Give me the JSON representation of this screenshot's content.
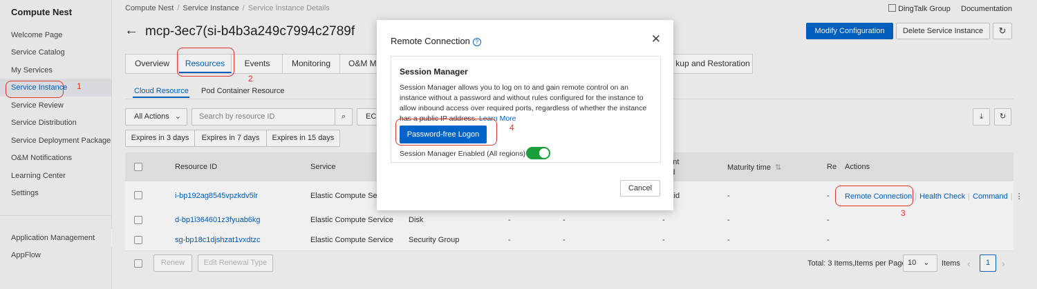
{
  "sidebar": {
    "title": "Compute Nest",
    "items": [
      {
        "label": "Welcome Page"
      },
      {
        "label": "Service Catalog"
      },
      {
        "label": "My Services"
      },
      {
        "label": "Service Instance"
      },
      {
        "label": "Service Review"
      },
      {
        "label": "Service Distribution"
      },
      {
        "label": "Service Deployment Package"
      },
      {
        "label": "O&M Notifications"
      },
      {
        "label": "Learning Center"
      },
      {
        "label": "Settings"
      }
    ],
    "bottom_items": [
      {
        "label": "Application Management"
      },
      {
        "label": "AppFlow"
      }
    ],
    "collapse_glyph": "‹"
  },
  "breadcrumb": {
    "items": [
      "Compute Nest",
      "Service Instance",
      "Service Instance Details"
    ],
    "sep": "/"
  },
  "topright": {
    "dingtalk": "DingTalk Group",
    "docs": "Documentation"
  },
  "header": {
    "back_glyph": "←",
    "title": "mcp-3ec7(si-b4b3a249c7994c2789f",
    "modify": "Modify Configuration",
    "delete": "Delete Service Instance",
    "refresh_glyph": "↻"
  },
  "tabs": [
    {
      "label": "Overview"
    },
    {
      "label": "Resources"
    },
    {
      "label": "Events"
    },
    {
      "label": "Monitoring"
    },
    {
      "label": "O&M Ma"
    },
    {
      "label": "kup and Restoration"
    }
  ],
  "subtabs": [
    {
      "label": "Cloud Resource"
    },
    {
      "label": "Pod Container Resource"
    }
  ],
  "toolbar": {
    "all_actions": "All Actions",
    "search_placeholder": "Search by resource ID",
    "ecs": "ECS",
    "expires": [
      "Expires in 3 days",
      "Expires in 7 days",
      "Expires in 15 days"
    ]
  },
  "table": {
    "headers": {
      "resource_id": "Resource ID",
      "service": "Service",
      "billing_1": "ment",
      "billing_2": "hod",
      "maturity": "Maturity time",
      "re": "Re",
      "actions": "Actions"
    },
    "rows": [
      {
        "id": "i-bp192ag8545vpzkdv5lr",
        "service": "Elastic Compute Service",
        "type": "",
        "c3": "",
        "c4": "",
        "billing": "tPaid",
        "maturity": "-",
        "re": "-"
      },
      {
        "id": "d-bp1i364601z3fyuab6kg",
        "service": "Elastic Compute Service",
        "type": "Disk",
        "c3": "-",
        "c4": "-",
        "billing": "-",
        "maturity": "-",
        "re": "-"
      },
      {
        "id": "sg-bp18c1djshzat1vxdtzc",
        "service": "Elastic Compute Service",
        "type": "Security Group",
        "c3": "-",
        "c4": "-",
        "billing": "-",
        "maturity": "-",
        "re": "-"
      }
    ],
    "row_actions": {
      "remote": "Remote Connection",
      "health": "Health Check",
      "command": "Command",
      "more": "⋮"
    }
  },
  "footer": {
    "renew": "Renew",
    "edit_renewal": "Edit Renewal Type",
    "total": "Total: 3 Items,",
    "per_page_label": "Items per Page",
    "per_page_value": "10",
    "items_suffix": "Items",
    "page": "1",
    "prev": "‹",
    "next": "›"
  },
  "modal": {
    "title": "Remote Connection",
    "help_glyph": "?",
    "close_glyph": "✕",
    "card_title": "Session Manager",
    "desc": "Session Manager allows you to log on to and gain remote control on an instance without a password and without rules configured for the instance to allow inbound access over required ports, regardless of whether the instance has a public IP address.",
    "learn_more": "Learn More",
    "logon": "Password-free Logon",
    "enabled_label": "Session Manager Enabled (All regions)",
    "cancel": "Cancel"
  },
  "annotations": [
    "1",
    "2",
    "3",
    "4"
  ],
  "colors": {
    "primary": "#0064c8",
    "annotation": "#e0342b",
    "toggle": "#1a9e3a"
  }
}
